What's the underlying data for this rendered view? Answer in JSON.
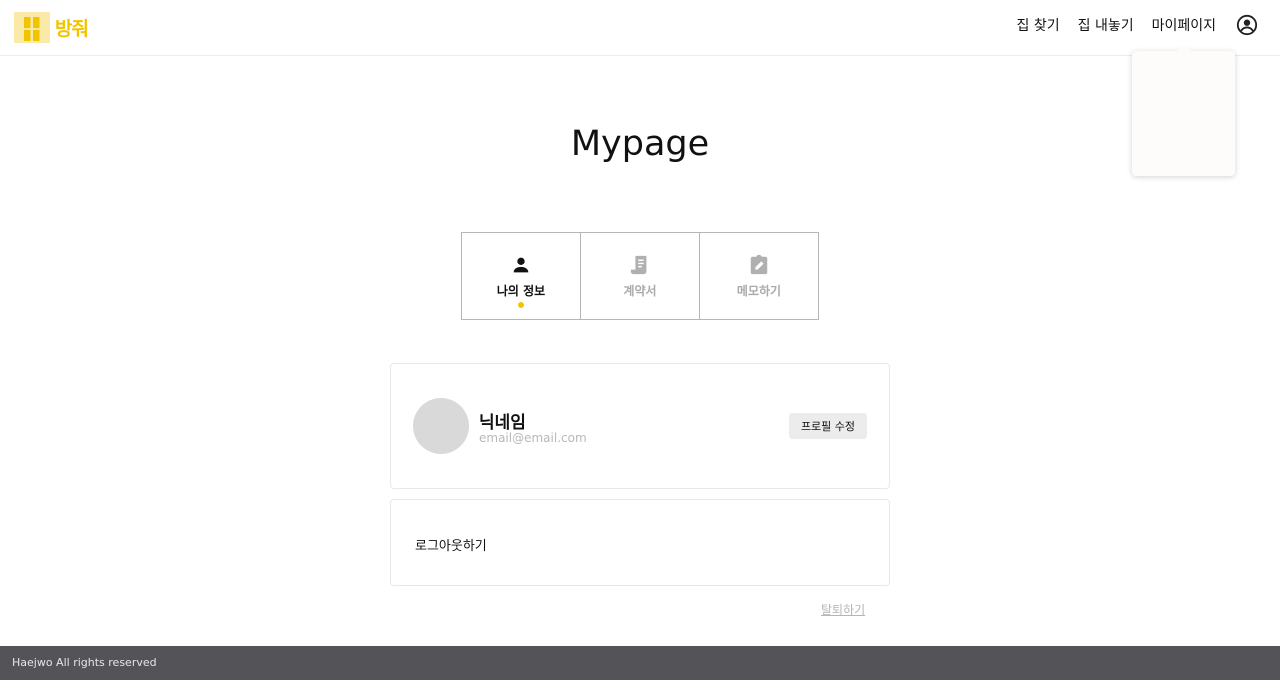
{
  "brand": {
    "name": "방줘",
    "color": "#f2c400"
  },
  "header": {
    "nav": [
      {
        "label": "집 찾기"
      },
      {
        "label": "집 내놓기"
      },
      {
        "label": "마이페이지"
      }
    ],
    "account_icon": "account-circle-icon"
  },
  "page": {
    "title": "Mypage"
  },
  "tabs": [
    {
      "label": "나의 정보",
      "icon": "person-icon",
      "active": true
    },
    {
      "label": "계약서",
      "icon": "document-icon",
      "active": false
    },
    {
      "label": "메모하기",
      "icon": "memo-edit-icon",
      "active": false
    }
  ],
  "profile": {
    "nickname": "닉네임",
    "email": "email@email.com",
    "edit_label": "프로필 수정"
  },
  "account": {
    "logout_label": "로그아웃하기",
    "withdraw_label": "탈퇴하기"
  },
  "footer": {
    "text": "Haejwo All rights reserved"
  },
  "colors": {
    "accent": "#f5c300",
    "footer_bg": "#545358",
    "inactive": "#aaaaaa"
  }
}
